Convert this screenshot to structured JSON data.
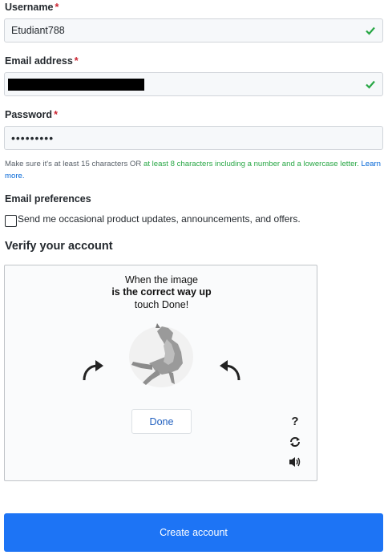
{
  "username": {
    "label": "Username",
    "required_mark": "*",
    "value": "Etudiant788"
  },
  "email": {
    "label": "Email address",
    "required_mark": "*",
    "value_state": "redacted"
  },
  "password": {
    "label": "Password",
    "required_mark": "*",
    "masked_value": "•••••••••"
  },
  "password_hint": {
    "part1": "Make sure it's at least 15 characters OR ",
    "part2": "at least 8 characters including a number and a lowercase letter.",
    "link": "Learn more."
  },
  "email_preferences": {
    "heading": "Email preferences",
    "checkbox_label": "Send me occasional product updates, announcements, and offers.",
    "checked": false
  },
  "verify": {
    "title": "Verify your account",
    "instruction_line1": "When the image",
    "instruction_line2": "is the correct way up",
    "instruction_line3": "touch Done!",
    "done_label": "Done",
    "help_icon": "?"
  },
  "create_button_label": "Create account",
  "colors": {
    "success": "#28a745",
    "primary": "#1d74f5",
    "required": "#cb2431",
    "link": "#0366d6"
  },
  "icons": [
    "check-icon",
    "rotate-left-arrow-icon",
    "rotate-right-arrow-icon",
    "help-icon",
    "refresh-icon",
    "audio-icon"
  ]
}
